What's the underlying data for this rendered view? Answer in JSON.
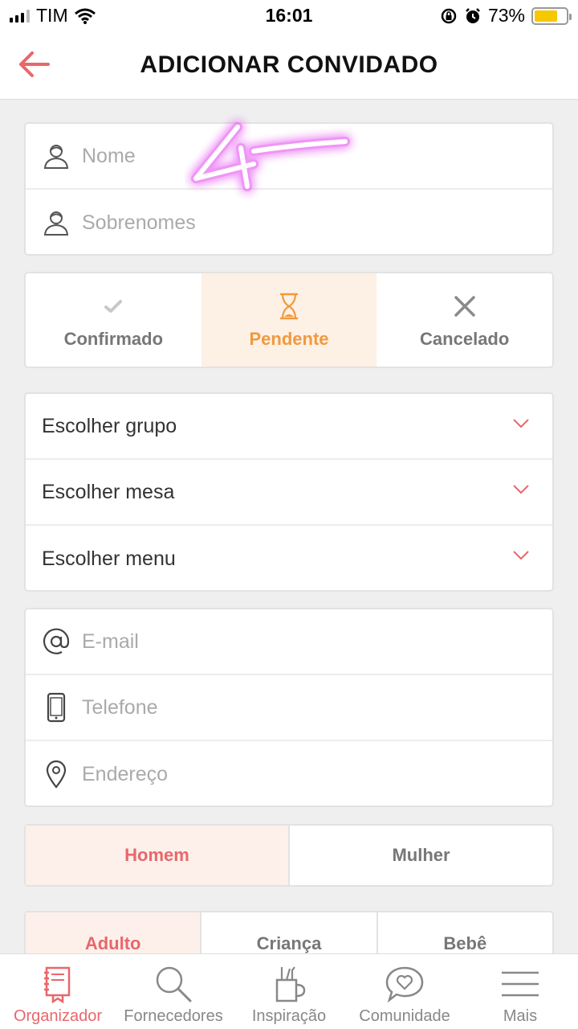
{
  "status_bar": {
    "carrier": "TIM",
    "time": "16:01",
    "battery": "73%",
    "battery_level": 0.73
  },
  "header": {
    "title": "ADICIONAR CONVIDADO"
  },
  "name_card": {
    "first_name": {
      "placeholder": "Nome",
      "value": ""
    },
    "last_name": {
      "placeholder": "Sobrenomes",
      "value": ""
    }
  },
  "status_seg": {
    "items": [
      {
        "label": "Confirmado",
        "icon": "check-icon"
      },
      {
        "label": "Pendente",
        "icon": "hourglass-icon"
      },
      {
        "label": "Cancelado",
        "icon": "close-icon"
      }
    ],
    "selected": "Pendente"
  },
  "selects": {
    "group": "Escolher grupo",
    "table": "Escolher mesa",
    "menu": "Escolher menu"
  },
  "contact_card": {
    "email": {
      "placeholder": "E-mail",
      "value": ""
    },
    "phone": {
      "placeholder": "Telefone",
      "value": ""
    },
    "address": {
      "placeholder": "Endereço",
      "value": ""
    }
  },
  "gender": {
    "options": [
      "Homem",
      "Mulher"
    ],
    "selected": "Homem"
  },
  "age": {
    "options": [
      "Adulto",
      "Criança",
      "Bebê"
    ],
    "selected": "Adulto"
  },
  "tabbar": {
    "items": [
      {
        "label": "Organizador",
        "icon": "notebook-icon"
      },
      {
        "label": "Fornecedores",
        "icon": "search-icon"
      },
      {
        "label": "Inspiração",
        "icon": "tools-cup-icon"
      },
      {
        "label": "Comunidade",
        "icon": "heart-bubble-icon"
      },
      {
        "label": "Mais",
        "icon": "menu-icon"
      }
    ],
    "active": "Organizador"
  },
  "annotation": {
    "text": "4"
  },
  "colors": {
    "accent": "#e8676b",
    "pending": "#f09a3e",
    "pending_bg": "#fdf0e4",
    "background": "#efefef"
  }
}
